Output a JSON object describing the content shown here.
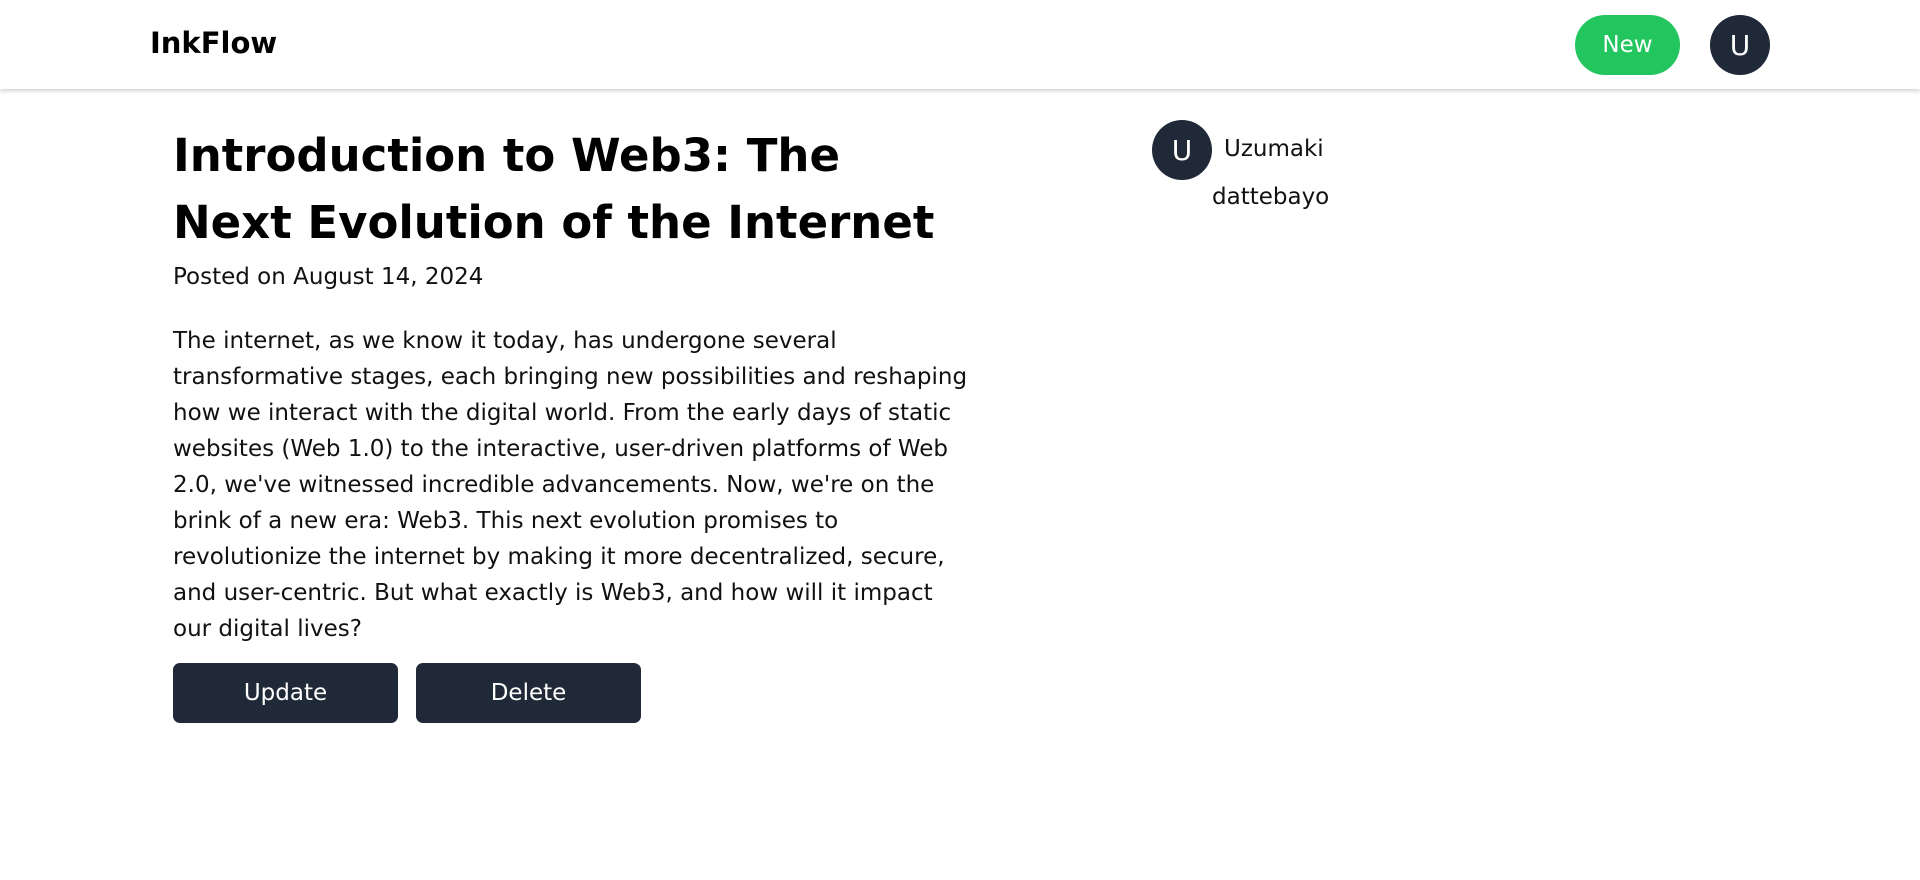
{
  "header": {
    "brand": "InkFlow",
    "new_button_label": "New",
    "user_avatar_initial": "U"
  },
  "post": {
    "title": "Introduction to Web3: The Next Evolution of the Internet",
    "posted_on": "Posted on August 14, 2024",
    "content": "The internet, as we know it today, has undergone several transformative stages, each bringing new possibilities and reshaping how we interact with the digital world. From the early days of static websites (Web 1.0) to the interactive, user-driven platforms of Web 2.0, we've witnessed incredible advancements. Now, we're on the brink of a new era: Web3. This next evolution promises to revolutionize the internet by making it more decentralized, secure, and user-centric. But what exactly is Web3, and how will it impact our digital lives?",
    "update_label": "Update",
    "delete_label": "Delete"
  },
  "author": {
    "avatar_initial": "U",
    "name": "Uzumaki",
    "bio": "dattebayo"
  },
  "colors": {
    "accent_green": "#22c55e",
    "dark": "#1f2937"
  }
}
